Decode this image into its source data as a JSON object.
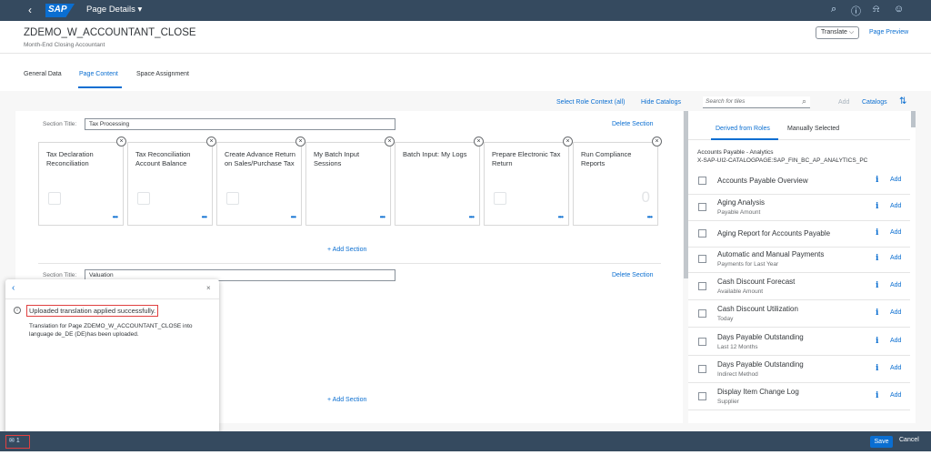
{
  "shell": {
    "logo": "SAP",
    "title": "Page Details ▾",
    "icons": [
      "search-icon",
      "help-icon",
      "bell-icon",
      "user-icon"
    ]
  },
  "header": {
    "title": "ZDEMO_W_ACCOUNTANT_CLOSE",
    "subtitle": "Month-End Closing Accountant",
    "translate_label": "Translate",
    "page_preview_label": "Page Preview"
  },
  "tabs": [
    "General Data",
    "Page Content",
    "Space Assignment"
  ],
  "toolbar": {
    "select_role_context": "Select Role Context (all)",
    "hide_catalogs": "Hide Catalogs",
    "search_placeholder": "Search for tiles",
    "add": "Add",
    "catalogs": "Catalogs"
  },
  "sections": [
    {
      "title_label": "Section Title:",
      "title_value": "Tax Processing",
      "delete_label": "Delete Section",
      "tiles": [
        "Tax Declaration Reconciliation",
        "Tax Reconciliation Account Balance",
        "Create Advance Return on Sales/Purchase Tax",
        "My Batch Input Sessions",
        "Batch Input: My Logs",
        "Prepare Electronic Tax Return",
        "Run Compliance Reports"
      ],
      "tile_number": "0",
      "add_section": "+ Add Section"
    },
    {
      "title_label": "Section Title:",
      "title_value": "Valuation",
      "delete_label": "Delete Section",
      "add_section": "+ Add Section"
    }
  ],
  "right_panel": {
    "tabs": [
      "Derived from Roles",
      "Manually Selected"
    ],
    "catalog_line1": "Accounts Payable - Analytics",
    "catalog_line2": "X-SAP-UI2-CATALOGPAGE:SAP_FIN_BC_AP_ANALYTICS_PC",
    "add_label": "Add",
    "items": [
      {
        "title": "Accounts Payable Overview",
        "subtitle": ""
      },
      {
        "title": "Aging Analysis",
        "subtitle": "Payable Amount"
      },
      {
        "title": "Aging Report for Accounts Payable",
        "subtitle": ""
      },
      {
        "title": "Automatic and Manual Payments",
        "subtitle": "Payments for Last Year"
      },
      {
        "title": "Cash Discount Forecast",
        "subtitle": "Available Amount"
      },
      {
        "title": "Cash Discount Utilization",
        "subtitle": "Today"
      },
      {
        "title": "Days Payable Outstanding",
        "subtitle": "Last 12 Months"
      },
      {
        "title": "Days Payable Outstanding",
        "subtitle": "Indirect Method"
      },
      {
        "title": "Display Item Change Log",
        "subtitle": "Supplier"
      }
    ]
  },
  "popover": {
    "message_title": "Uploaded translation applied successfully.",
    "message_desc": "Translation for Page ZDEMO_W_ACCOUNTANT_CLOSE into language de_DE (DE)has been uploaded."
  },
  "footer": {
    "message_count": "1",
    "save": "Save",
    "cancel": "Cancel"
  },
  "colors": {
    "shell": "#354a5f",
    "accent": "#0a6ed1",
    "highlight": "#e04040"
  }
}
